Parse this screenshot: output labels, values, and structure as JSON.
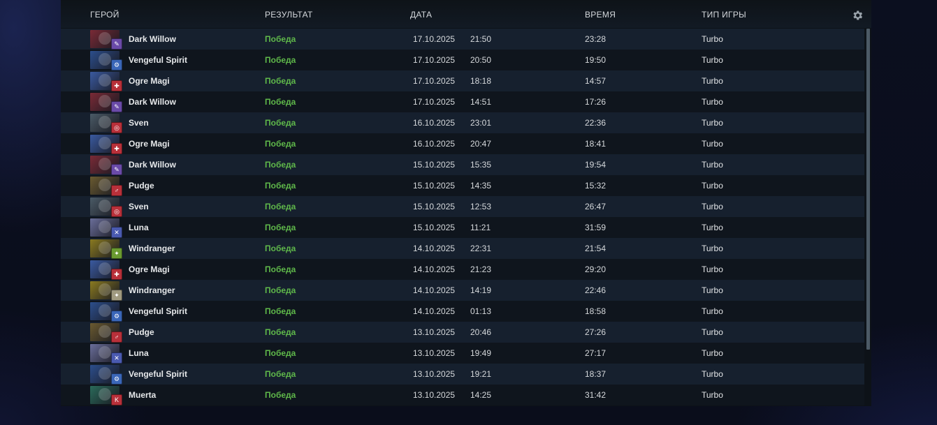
{
  "header": {
    "hero": "ГЕРОЙ",
    "result": "РЕЗУЛЬТАТ",
    "date": "ДАТА",
    "duration": "ВРЕМЯ",
    "game_type": "ТИП ИГРЫ",
    "settings_icon": "gear-icon"
  },
  "matches": [
    {
      "hero": "Dark Willow",
      "result": "Победа",
      "date": "17.10.2025",
      "time": "21:50",
      "duration": "23:28",
      "mode": "Turbo",
      "portrait": "#7a2a36",
      "attr_color": "#6a4aa8",
      "attr_glyph": "✎"
    },
    {
      "hero": "Vengeful Spirit",
      "result": "Победа",
      "date": "17.10.2025",
      "time": "20:50",
      "duration": "19:50",
      "mode": "Turbo",
      "portrait": "#2c4e8c",
      "attr_color": "#3a66b8",
      "attr_glyph": "⚙"
    },
    {
      "hero": "Ogre Magi",
      "result": "Победа",
      "date": "17.10.2025",
      "time": "18:18",
      "duration": "14:57",
      "mode": "Turbo",
      "portrait": "#3a5aa0",
      "attr_color": "#b8303a",
      "attr_glyph": "✚"
    },
    {
      "hero": "Dark Willow",
      "result": "Победа",
      "date": "17.10.2025",
      "time": "14:51",
      "duration": "17:26",
      "mode": "Turbo",
      "portrait": "#7a2a36",
      "attr_color": "#6a4aa8",
      "attr_glyph": "✎"
    },
    {
      "hero": "Sven",
      "result": "Победа",
      "date": "16.10.2025",
      "time": "23:01",
      "duration": "22:36",
      "mode": "Turbo",
      "portrait": "#4a5a66",
      "attr_color": "#b8303a",
      "attr_glyph": "◎"
    },
    {
      "hero": "Ogre Magi",
      "result": "Победа",
      "date": "16.10.2025",
      "time": "20:47",
      "duration": "18:41",
      "mode": "Turbo",
      "portrait": "#3a5aa0",
      "attr_color": "#b8303a",
      "attr_glyph": "✚"
    },
    {
      "hero": "Dark Willow",
      "result": "Победа",
      "date": "15.10.2025",
      "time": "15:35",
      "duration": "19:54",
      "mode": "Turbo",
      "portrait": "#7a2a36",
      "attr_color": "#6a4aa8",
      "attr_glyph": "✎"
    },
    {
      "hero": "Pudge",
      "result": "Победа",
      "date": "15.10.2025",
      "time": "14:35",
      "duration": "15:32",
      "mode": "Turbo",
      "portrait": "#6a5a30",
      "attr_color": "#b8303a",
      "attr_glyph": "♂"
    },
    {
      "hero": "Sven",
      "result": "Победа",
      "date": "15.10.2025",
      "time": "12:53",
      "duration": "26:47",
      "mode": "Turbo",
      "portrait": "#4a5a66",
      "attr_color": "#b8303a",
      "attr_glyph": "◎"
    },
    {
      "hero": "Luna",
      "result": "Победа",
      "date": "15.10.2025",
      "time": "11:21",
      "duration": "31:59",
      "mode": "Turbo",
      "portrait": "#6a6e9a",
      "attr_color": "#4a5ab0",
      "attr_glyph": "✕"
    },
    {
      "hero": "Windranger",
      "result": "Победа",
      "date": "14.10.2025",
      "time": "22:31",
      "duration": "21:54",
      "mode": "Turbo",
      "portrait": "#8a7a20",
      "attr_color": "#6a9a30",
      "attr_glyph": "✦"
    },
    {
      "hero": "Ogre Magi",
      "result": "Победа",
      "date": "14.10.2025",
      "time": "21:23",
      "duration": "29:20",
      "mode": "Turbo",
      "portrait": "#3a5aa0",
      "attr_color": "#b8303a",
      "attr_glyph": "✚"
    },
    {
      "hero": "Windranger",
      "result": "Победа",
      "date": "14.10.2025",
      "time": "14:19",
      "duration": "22:46",
      "mode": "Turbo",
      "portrait": "#8a7a20",
      "attr_color": "#a09a80",
      "attr_glyph": "✦"
    },
    {
      "hero": "Vengeful Spirit",
      "result": "Победа",
      "date": "14.10.2025",
      "time": "01:13",
      "duration": "18:58",
      "mode": "Turbo",
      "portrait": "#2c4e8c",
      "attr_color": "#3a66b8",
      "attr_glyph": "⚙"
    },
    {
      "hero": "Pudge",
      "result": "Победа",
      "date": "13.10.2025",
      "time": "20:46",
      "duration": "27:26",
      "mode": "Turbo",
      "portrait": "#6a5a30",
      "attr_color": "#b8303a",
      "attr_glyph": "♂"
    },
    {
      "hero": "Luna",
      "result": "Победа",
      "date": "13.10.2025",
      "time": "19:49",
      "duration": "27:17",
      "mode": "Turbo",
      "portrait": "#6a6e9a",
      "attr_color": "#4a5ab0",
      "attr_glyph": "✕"
    },
    {
      "hero": "Vengeful Spirit",
      "result": "Победа",
      "date": "13.10.2025",
      "time": "19:21",
      "duration": "18:37",
      "mode": "Turbo",
      "portrait": "#2c4e8c",
      "attr_color": "#3a66b8",
      "attr_glyph": "⚙"
    },
    {
      "hero": "Muerta",
      "result": "Победа",
      "date": "13.10.2025",
      "time": "14:25",
      "duration": "31:42",
      "mode": "Turbo",
      "portrait": "#2a6a5a",
      "attr_color": "#b8303a",
      "attr_glyph": "K"
    }
  ]
}
